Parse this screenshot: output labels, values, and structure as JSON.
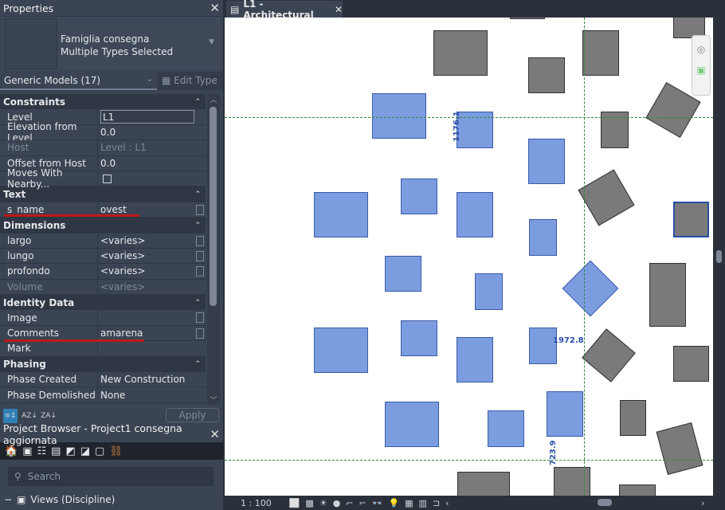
{
  "properties": {
    "title": "Properties",
    "family": "Famiglia consegna",
    "type": "Multiple Types Selected",
    "category": "Generic Models (17)",
    "edit_type": "Edit Type",
    "apply": "Apply",
    "groups": [
      {
        "name": "Constraints",
        "rows": [
          {
            "k": "Level",
            "v": "L1"
          },
          {
            "k": "Elevation from Level",
            "v": "0.0"
          },
          {
            "k": "Host",
            "v": "Level : L1"
          },
          {
            "k": "Offset from Host",
            "v": "0.0"
          },
          {
            "k": "Moves With Nearby...",
            "v": ""
          }
        ]
      },
      {
        "name": "Text",
        "rows": [
          {
            "k": "s_name",
            "v": "ovest"
          }
        ]
      },
      {
        "name": "Dimensions",
        "rows": [
          {
            "k": "largo",
            "v": "<varies>"
          },
          {
            "k": "lungo",
            "v": "<varies>"
          },
          {
            "k": "profondo",
            "v": "<varies>"
          },
          {
            "k": "Volume",
            "v": "<varies>"
          }
        ]
      },
      {
        "name": "Identity Data",
        "rows": [
          {
            "k": "Image",
            "v": ""
          },
          {
            "k": "Comments",
            "v": "amarena"
          },
          {
            "k": "Mark",
            "v": ""
          }
        ]
      },
      {
        "name": "Phasing",
        "rows": [
          {
            "k": "Phase Created",
            "v": "New Construction"
          },
          {
            "k": "Phase Demolished",
            "v": "None"
          }
        ]
      }
    ]
  },
  "browser": {
    "title": "Project Browser - Project1 consegna aggiornata",
    "search_placeholder": "Search",
    "root": "Views (Discipline)"
  },
  "view": {
    "tab": "L1 - Architectural",
    "scale": "1 : 100",
    "dims": [
      "1176.1",
      "1972.8",
      "723.9"
    ]
  },
  "colors": {
    "element": "#7b9de0",
    "existing": "#7a7a7a",
    "grid": "#2e8b3a",
    "annotation": "#c01818"
  }
}
